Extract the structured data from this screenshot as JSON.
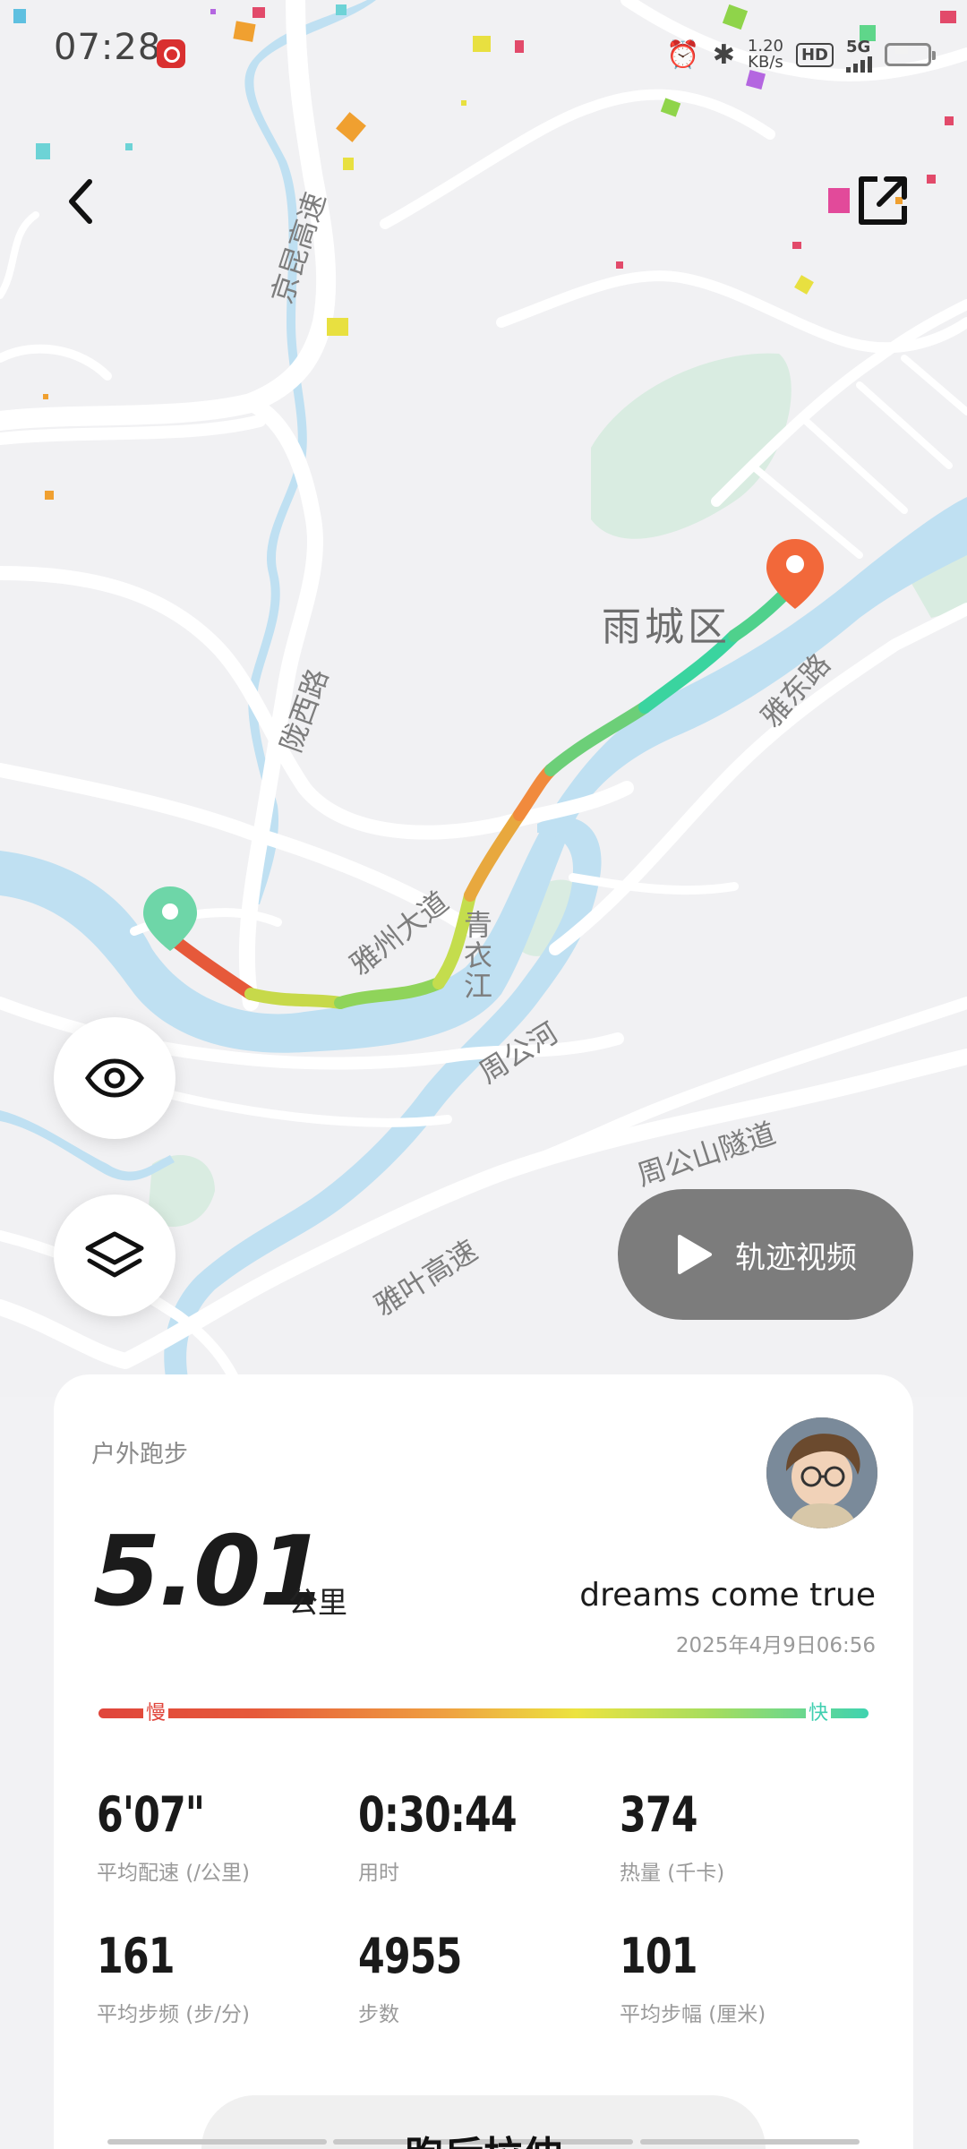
{
  "status_bar": {
    "time": "07:28",
    "net_speed": "1.20",
    "net_speed_unit": "KB/s",
    "hd_label": "HD",
    "net_type": "5G"
  },
  "map": {
    "district": "雨城区",
    "roads": {
      "jingkun": "京昆高速",
      "longxi": "陇西路",
      "yadong": "雅东路",
      "yazhou": "雅州大道",
      "qingyi": "青衣江",
      "zhougong_river": "周公河",
      "zhougong_tunnel": "周公山隧道",
      "yaye": "雅叶高速"
    }
  },
  "actions": {
    "track_video_label": "轨迹视频"
  },
  "icons": {
    "back": "chevron-left-icon",
    "share": "external-link-icon",
    "eye": "eye-icon",
    "layers": "layers-icon",
    "play": "play-icon"
  },
  "card": {
    "sport_type": "户外跑步",
    "distance_value": "5.01",
    "distance_unit": "公里",
    "username": "dreams come true",
    "datetime": "2025年4月9日06:56",
    "pace_slow": "慢",
    "pace_fast": "快",
    "stats": [
      {
        "value": "6'07\"",
        "label": "平均配速 (/公里)"
      },
      {
        "value": "0:30:44",
        "label": "用时"
      },
      {
        "value": "374",
        "label": "热量 (千卡)"
      },
      {
        "value": "161",
        "label": "平均步频 (步/分)"
      },
      {
        "value": "4955",
        "label": "步数"
      },
      {
        "value": "101",
        "label": "平均步幅 (厘米)"
      }
    ],
    "bottom_button_label": "跑后拉伸"
  },
  "colors": {
    "route_fast": "#3fd3a0",
    "route_slow": "#e6453b",
    "start_pin": "#6dd4a4",
    "end_pin": "#f26a3c",
    "river": "#bfe0f2",
    "park": "#d8ece0"
  }
}
